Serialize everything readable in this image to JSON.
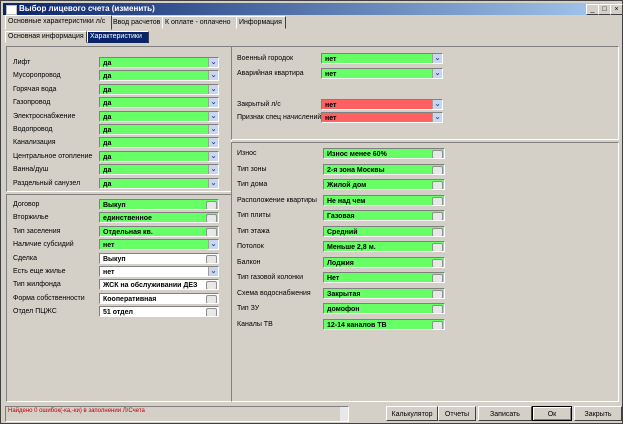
{
  "window": {
    "title": "Выбор лицевого счета (изменить)",
    "minimize": "_",
    "maximize": "□",
    "close": "×"
  },
  "tabs": [
    "Основные характеристики л/с",
    "Ввод расчетов",
    "К оплате - оплачено",
    "Информация"
  ],
  "subtabs": [
    "Основная информация",
    "Характеристики"
  ],
  "left_top": [
    {
      "label": "Лифт",
      "value": "да"
    },
    {
      "label": "Мусоропровод",
      "value": "да"
    },
    {
      "label": "Горячая вода",
      "value": "да"
    },
    {
      "label": "Газопровод",
      "value": "да"
    },
    {
      "label": "Электроснабжение",
      "value": "да"
    },
    {
      "label": "Водопровод",
      "value": "да"
    },
    {
      "label": "Канализация",
      "value": "да"
    },
    {
      "label": "Центральное отопление",
      "value": "да"
    },
    {
      "label": "Ванна/душ",
      "value": "да"
    },
    {
      "label": "Раздельный санузел",
      "value": "да"
    }
  ],
  "left_bottom": [
    {
      "label": "Договор",
      "value": "Выкуп"
    },
    {
      "label": "Вторжилье",
      "value": "единственное"
    },
    {
      "label": "Тип заселения",
      "value": "Отдельная кв."
    },
    {
      "label": "Наличие субсидий",
      "value": "нет"
    },
    {
      "label": "Сделка",
      "value": "Выкуп"
    },
    {
      "label": "Есть еще жилье",
      "value": "нет"
    },
    {
      "label": "Тип жилфонда",
      "value": "ЖСК на обслуживании ДЕЗ"
    },
    {
      "label": "Форма собственности",
      "value": "Кооперативная"
    },
    {
      "label": "Отдел ПЦЖС",
      "value": "51 отдел"
    }
  ],
  "right_top": [
    {
      "label": "Военный городок",
      "value": "нет"
    },
    {
      "label": "Аварийная квартира",
      "value": "нет"
    },
    {
      "label": "Закрытый л/с",
      "value": "нет"
    },
    {
      "label": "Признак спец начислений",
      "value": "нет"
    }
  ],
  "right_bottom": [
    {
      "label": "Износ",
      "value": "Износ менее 60%"
    },
    {
      "label": "Тип зоны",
      "value": "2-я зона Москвы"
    },
    {
      "label": "Тип дома",
      "value": "Жилой дом"
    },
    {
      "label": "Расположение квартиры",
      "value": "Не над чем"
    },
    {
      "label": "Тип плиты",
      "value": "Газовая"
    },
    {
      "label": "Тип этажа",
      "value": "Средний"
    },
    {
      "label": "Потолок",
      "value": "Меньше 2,8 м."
    },
    {
      "label": "Балкон",
      "value": "Лоджия"
    },
    {
      "label": "Тип газовой колонки",
      "value": "Нет"
    },
    {
      "label": "Схема водоснабжения",
      "value": "Закрытая"
    },
    {
      "label": "Тип ЗУ",
      "value": "домофон"
    },
    {
      "label": "Каналы ТВ",
      "value": "12-14 каналов ТВ"
    }
  ],
  "status": "Найдено 0 ошибок(-ка,-ки) в заполнении Л/Счета",
  "buttons": [
    "Калькулятор",
    "Отчеты",
    "Записать",
    "Ок",
    "Закрыть"
  ],
  "colors": {
    "ok": "#66ff66",
    "alert": "#ff6060",
    "title": "#0a246a"
  }
}
